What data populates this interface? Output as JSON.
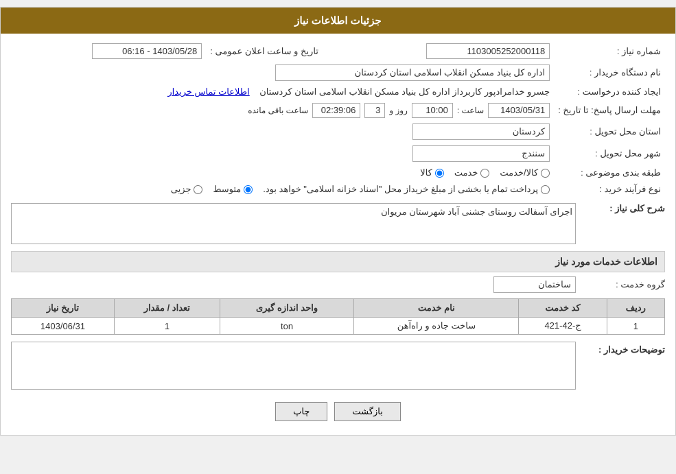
{
  "header": {
    "title": "جزئیات اطلاعات نیاز"
  },
  "fields": {
    "need_number_label": "شماره نیاز :",
    "need_number_value": "1103005252000118",
    "announcement_date_label": "تاریخ و ساعت اعلان عمومی :",
    "announcement_date_value": "1403/05/28 - 06:16",
    "buyer_org_label": "نام دستگاه خریدار :",
    "buyer_org_value": "اداره کل بنیاد مسکن انقلاب اسلامی استان کردستان",
    "creator_label": "ایجاد کننده درخواست :",
    "creator_value": "جسرو خدامرادپور کاربرداز اداره کل بنیاد مسکن انقلاب اسلامی استان کردستان",
    "contact_link": "اطلاعات تماس خریدار",
    "deadline_label": "مهلت ارسال پاسخ: تا تاریخ :",
    "deadline_date": "1403/05/31",
    "deadline_time_label": "ساعت :",
    "deadline_time": "10:00",
    "deadline_days_label": "روز و",
    "deadline_days": "3",
    "remaining_label": "ساعت باقی مانده",
    "remaining_time": "02:39:06",
    "province_label": "استان محل تحویل :",
    "province_value": "کردستان",
    "city_label": "شهر محل تحویل :",
    "city_value": "سنندج",
    "category_label": "طبقه بندی موضوعی :",
    "category_options": [
      {
        "label": "کالا",
        "name": "cat",
        "value": "kala"
      },
      {
        "label": "خدمت",
        "name": "cat",
        "value": "khedmat"
      },
      {
        "label": "کالا/خدمت",
        "name": "cat",
        "value": "both"
      }
    ],
    "purchase_type_label": "نوع فرآیند خرید :",
    "purchase_options": [
      {
        "label": "جزیی",
        "name": "ptype",
        "value": "jozi"
      },
      {
        "label": "متوسط",
        "name": "ptype",
        "value": "motavaset"
      },
      {
        "label": "پرداخت تمام یا بخشی از مبلغ خریداز محل \"اسناد خزانه اسلامی\" خواهد بود.",
        "name": "ptype",
        "value": "esnad"
      }
    ],
    "description_label": "شرح کلی نیاز :",
    "description_value": "اجرای آسفالت روستای جشنی آباد شهرستان مریوان",
    "services_section_title": "اطلاعات خدمات مورد نیاز",
    "service_group_label": "گروه خدمت :",
    "service_group_value": "ساختمان",
    "table_headers": [
      "ردیف",
      "کد خدمت",
      "نام خدمت",
      "واحد اندازه گیری",
      "تعداد / مقدار",
      "تاریخ نیاز"
    ],
    "table_rows": [
      {
        "row": "1",
        "code": "ج-42-421",
        "name": "ساخت جاده و راه‌آهن",
        "unit": "ton",
        "quantity": "1",
        "date": "1403/06/31"
      }
    ],
    "buyer_notes_label": "توضیحات خریدار :",
    "buyer_notes_value": ""
  },
  "buttons": {
    "print": "چاپ",
    "back": "بازگشت"
  },
  "colors": {
    "header_bg": "#8B6914",
    "section_bg": "#e8e8e8",
    "link": "#0000cc"
  }
}
